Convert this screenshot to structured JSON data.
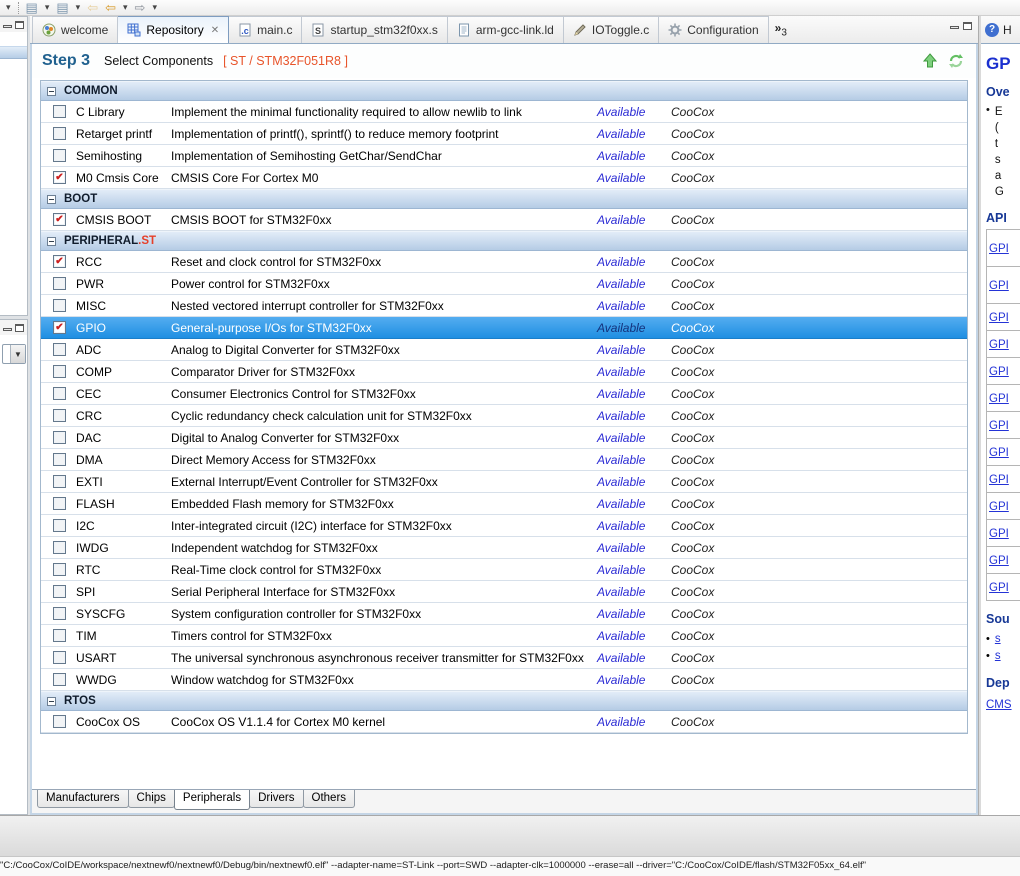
{
  "colors": {
    "selection_blue_top": "#54adf0",
    "selection_blue_bottom": "#1f8fe2",
    "section_header_top": "#e2ecf8",
    "section_header_bottom": "#b5cce5",
    "status_available_blue": "#2a2ad4",
    "checkbox_check_red": "#cc1f1f",
    "device_label_orange": "#e8542a",
    "step_label_blue": "#20618f",
    "help_link_blue": "#2433d6"
  },
  "toolbar": {
    "icons": [
      "dropdown-icon",
      "separator",
      "window-icon",
      "dropdown-icon",
      "window-icon",
      "dropdown-icon",
      "back-pale-icon",
      "back-icon",
      "dropdown-icon",
      "forward-icon",
      "dropdown-icon"
    ]
  },
  "editor_tabs": {
    "tabs": [
      {
        "label": "welcome",
        "icon": "coide-logo",
        "active": false,
        "closable": false
      },
      {
        "label": "Repository",
        "icon": "repository-grid",
        "active": true,
        "closable": true
      },
      {
        "label": "main.c",
        "icon": "c-file",
        "active": false,
        "closable": false
      },
      {
        "label": "startup_stm32f0xx.s",
        "icon": "s-file",
        "active": false,
        "closable": false
      },
      {
        "label": "arm-gcc-link.ld",
        "icon": "document",
        "active": false,
        "closable": false
      },
      {
        "label": "IOToggle.c",
        "icon": "pencil",
        "active": false,
        "closable": false
      },
      {
        "label": "Configuration",
        "icon": "gear",
        "active": false,
        "closable": false
      }
    ],
    "overflow_count": "3"
  },
  "repository_view": {
    "step_label": "Step 3",
    "step_subtitle": "Select Components",
    "device_label": "[ ST / STM32F051R8 ]",
    "action_icons": [
      "upload-icon",
      "refresh-icon"
    ],
    "sections": [
      {
        "title": "COMMON",
        "suffix": "",
        "rows": [
          {
            "checked": false,
            "selected": false,
            "name": "C Library",
            "description": "Implement the minimal functionality required to allow newlib to link",
            "status": "Available",
            "vendor": "CooCox"
          },
          {
            "checked": false,
            "selected": false,
            "name": "Retarget printf",
            "description": "Implementation of printf(), sprintf() to reduce memory footprint",
            "status": "Available",
            "vendor": "CooCox"
          },
          {
            "checked": false,
            "selected": false,
            "name": "Semihosting",
            "description": "Implementation of Semihosting GetChar/SendChar",
            "status": "Available",
            "vendor": "CooCox"
          },
          {
            "checked": true,
            "selected": false,
            "name": "M0 Cmsis Core",
            "description": "CMSIS Core For Cortex M0",
            "status": "Available",
            "vendor": "CooCox"
          }
        ]
      },
      {
        "title": "BOOT",
        "suffix": "",
        "rows": [
          {
            "checked": true,
            "selected": false,
            "name": "CMSIS BOOT",
            "description": "CMSIS BOOT for STM32F0xx",
            "status": "Available",
            "vendor": "CooCox"
          }
        ]
      },
      {
        "title": "PERIPHERAL",
        "suffix": ".ST",
        "rows": [
          {
            "checked": true,
            "selected": false,
            "name": "RCC",
            "description": "Reset and clock control for STM32F0xx",
            "status": "Available",
            "vendor": "CooCox"
          },
          {
            "checked": false,
            "selected": false,
            "name": "PWR",
            "description": "Power control for STM32F0xx",
            "status": "Available",
            "vendor": "CooCox"
          },
          {
            "checked": false,
            "selected": false,
            "name": "MISC",
            "description": "Nested vectored interrupt controller for STM32F0xx",
            "status": "Available",
            "vendor": "CooCox"
          },
          {
            "checked": true,
            "selected": true,
            "name": "GPIO",
            "description": "General-purpose I/Os for STM32F0xx",
            "status": "Available",
            "vendor": "CooCox"
          },
          {
            "checked": false,
            "selected": false,
            "name": "ADC",
            "description": "Analog to Digital Converter for STM32F0xx",
            "status": "Available",
            "vendor": "CooCox"
          },
          {
            "checked": false,
            "selected": false,
            "name": "COMP",
            "description": "Comparator Driver for STM32F0xx",
            "status": "Available",
            "vendor": "CooCox"
          },
          {
            "checked": false,
            "selected": false,
            "name": "CEC",
            "description": "Consumer Electronics Control for STM32F0xx",
            "status": "Available",
            "vendor": "CooCox"
          },
          {
            "checked": false,
            "selected": false,
            "name": "CRC",
            "description": "Cyclic redundancy check calculation unit for STM32F0xx",
            "status": "Available",
            "vendor": "CooCox"
          },
          {
            "checked": false,
            "selected": false,
            "name": "DAC",
            "description": "Digital to Analog Converter for STM32F0xx",
            "status": "Available",
            "vendor": "CooCox"
          },
          {
            "checked": false,
            "selected": false,
            "name": "DMA",
            "description": "Direct Memory Access for STM32F0xx",
            "status": "Available",
            "vendor": "CooCox"
          },
          {
            "checked": false,
            "selected": false,
            "name": "EXTI",
            "description": "External Interrupt/Event Controller for STM32F0xx",
            "status": "Available",
            "vendor": "CooCox"
          },
          {
            "checked": false,
            "selected": false,
            "name": "FLASH",
            "description": "Embedded Flash memory for STM32F0xx",
            "status": "Available",
            "vendor": "CooCox"
          },
          {
            "checked": false,
            "selected": false,
            "name": "I2C",
            "description": "Inter-integrated circuit (I2C) interface for STM32F0xx",
            "status": "Available",
            "vendor": "CooCox"
          },
          {
            "checked": false,
            "selected": false,
            "name": "IWDG",
            "description": "Independent watchdog for STM32F0xx",
            "status": "Available",
            "vendor": "CooCox"
          },
          {
            "checked": false,
            "selected": false,
            "name": "RTC",
            "description": "Real-Time clock control for STM32F0xx",
            "status": "Available",
            "vendor": "CooCox"
          },
          {
            "checked": false,
            "selected": false,
            "name": "SPI",
            "description": "Serial Peripheral Interface for STM32F0xx",
            "status": "Available",
            "vendor": "CooCox"
          },
          {
            "checked": false,
            "selected": false,
            "name": "SYSCFG",
            "description": "System configuration controller for STM32F0xx",
            "status": "Available",
            "vendor": "CooCox"
          },
          {
            "checked": false,
            "selected": false,
            "name": "TIM",
            "description": "Timers control for STM32F0xx",
            "status": "Available",
            "vendor": "CooCox"
          },
          {
            "checked": false,
            "selected": false,
            "name": "USART",
            "description": "The universal synchronous asynchronous receiver transmitter for STM32F0xx",
            "status": "Available",
            "vendor": "CooCox"
          },
          {
            "checked": false,
            "selected": false,
            "name": "WWDG",
            "description": "Window watchdog for STM32F0xx",
            "status": "Available",
            "vendor": "CooCox"
          }
        ]
      },
      {
        "title": "RTOS",
        "suffix": "",
        "rows": [
          {
            "checked": false,
            "selected": false,
            "name": "CooCox OS",
            "description": "CooCox OS V1.1.4 for Cortex M0 kernel",
            "status": "Available",
            "vendor": "CooCox"
          }
        ]
      }
    ],
    "bottom_tabs": [
      {
        "label": "Manufacturers",
        "active": false
      },
      {
        "label": "Chips",
        "active": false
      },
      {
        "label": "Peripherals",
        "active": true
      },
      {
        "label": "Drivers",
        "active": false
      },
      {
        "label": "Others",
        "active": false
      }
    ]
  },
  "help_panel": {
    "tab_label": "H",
    "title": "GP",
    "overview_heading": "Ove",
    "overview_lines": [
      "E",
      "(",
      "t",
      "s",
      "a",
      "G"
    ],
    "api_heading": "API",
    "api_links": [
      "GPI",
      "GPI",
      "GPI",
      "GPI",
      "GPI",
      "GPI",
      "GPI",
      "GPI",
      "GPI",
      "GPI",
      "GPI",
      "GPI",
      "GPI"
    ],
    "sources_heading": "Sou",
    "source_links": [
      "s",
      "s"
    ],
    "dependence_heading": "Dep",
    "dependence_links": [
      "CMS"
    ]
  },
  "status_bar": {
    "command": "\"C:/CooCox/CoIDE/workspace/nextnewf0/nextnewf0/Debug/bin/nextnewf0.elf\" --adapter-name=ST-Link --port=SWD --adapter-clk=1000000 --erase=all --driver=\"C:/CooCox/CoIDE/flash/STM32F05xx_64.elf\""
  }
}
